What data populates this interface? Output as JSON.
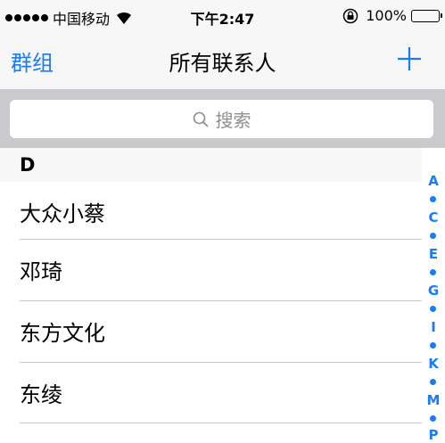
{
  "status_bar": {
    "carrier": "中国移动",
    "time": "下午2:47",
    "battery": "100%",
    "battery_level": 1.0
  },
  "nav": {
    "left": "群组",
    "title": "所有联系人"
  },
  "search": {
    "placeholder": "搜索"
  },
  "section": "D",
  "contacts": [
    "大众小蔡",
    "邓琦",
    "东方文化",
    "东绫"
  ],
  "index": [
    "A",
    "C",
    "E",
    "G",
    "I",
    "K",
    "M",
    "P"
  ],
  "colors": {
    "accent": "#1a7cf5",
    "bar": "#f7f7f7",
    "search_bg": "#c9c9ce"
  }
}
